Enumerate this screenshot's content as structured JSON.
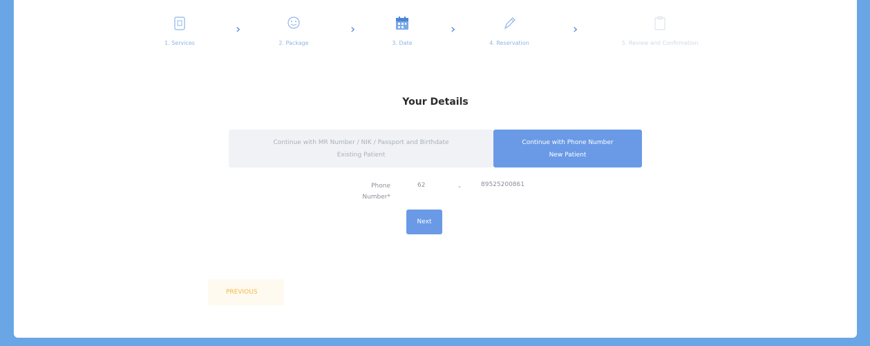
{
  "stepper": {
    "steps": [
      {
        "label": "1. Services",
        "icon": "document-icon"
      },
      {
        "label": "2. Package",
        "icon": "face-icon"
      },
      {
        "label": "3. Date",
        "icon": "calendar-icon"
      },
      {
        "label": "4. Reservation",
        "icon": "pencil-icon"
      },
      {
        "label": "5. Review and Confirmation",
        "icon": "clipboard-icon"
      }
    ],
    "separator": "›"
  },
  "details": {
    "title": "Your Details",
    "option_existing": {
      "line1": "Continue with MR Number / NIK / Passport and Birthdate",
      "line2": "Existing Patient"
    },
    "option_new": {
      "line1": "Continue with Phone Number",
      "line2": "New Patient"
    },
    "phone": {
      "label_line1": "Phone",
      "label_line2": "Number*",
      "country_code": "62",
      "number": "89525200861"
    },
    "next_label": "Next"
  },
  "nav": {
    "previous_label": "PREVIOUS"
  },
  "colors": {
    "accent": "#6a9ae6",
    "background": "#6aa6e6",
    "previous_text": "#f0b84a"
  }
}
